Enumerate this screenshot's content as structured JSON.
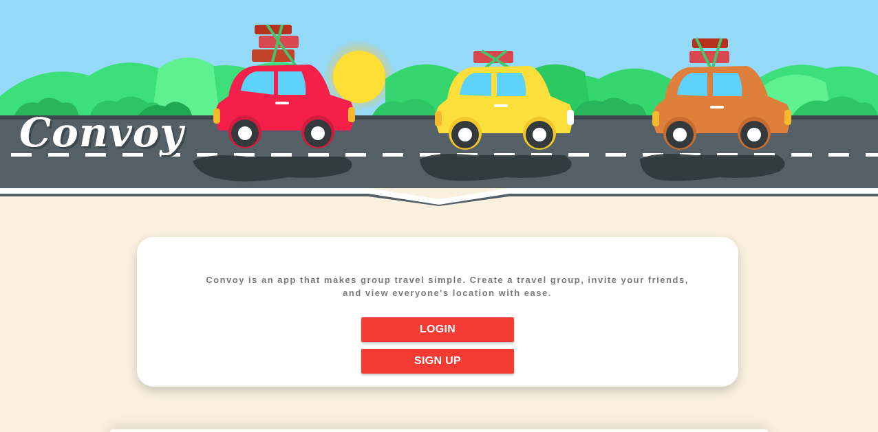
{
  "app": {
    "title": "Convoy"
  },
  "colors": {
    "sky": "#95dbf9",
    "road": "#545f66",
    "background": "#f9f0df",
    "button": "#f33b34",
    "car_red": "#f5204a",
    "car_yellow": "#fcdf3a",
    "car_orange": "#de7f3c",
    "hills": "#2fd96e"
  },
  "card": {
    "description": "Convoy is an app that makes group travel simple. Create a travel group, invite your friends, and view everyone's location with ease.",
    "login_label": "LOGIN",
    "signup_label": "SIGN UP"
  }
}
